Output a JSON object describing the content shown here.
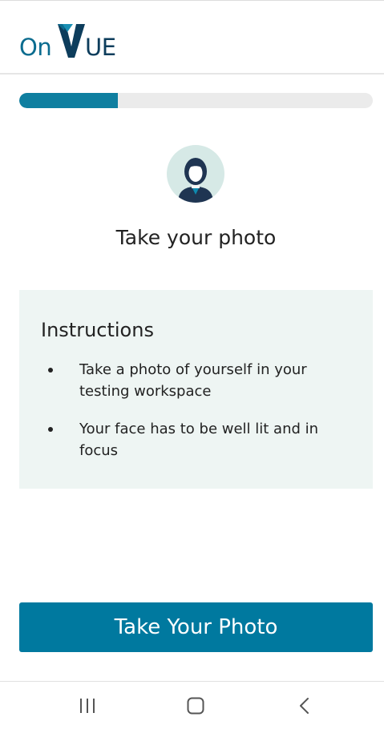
{
  "app": {
    "logo_on": "On",
    "logo_ue": "UE",
    "brand_colors": {
      "teal": "#0b6c8f",
      "navy": "#0d3d5c",
      "accent": "#00799f"
    }
  },
  "progress": {
    "fraction": 0.28
  },
  "avatar": {
    "icon": "person-avatar-icon"
  },
  "page": {
    "title": "Take your photo"
  },
  "instructions": {
    "title": "Instructions",
    "items": [
      "Take a photo of yourself in your testing workspace",
      "Your face has to be well lit and in focus"
    ]
  },
  "actions": {
    "primary_label": "Take Your Photo"
  },
  "system_nav": {
    "icons": [
      "recent-apps-icon",
      "home-icon",
      "back-icon"
    ]
  }
}
